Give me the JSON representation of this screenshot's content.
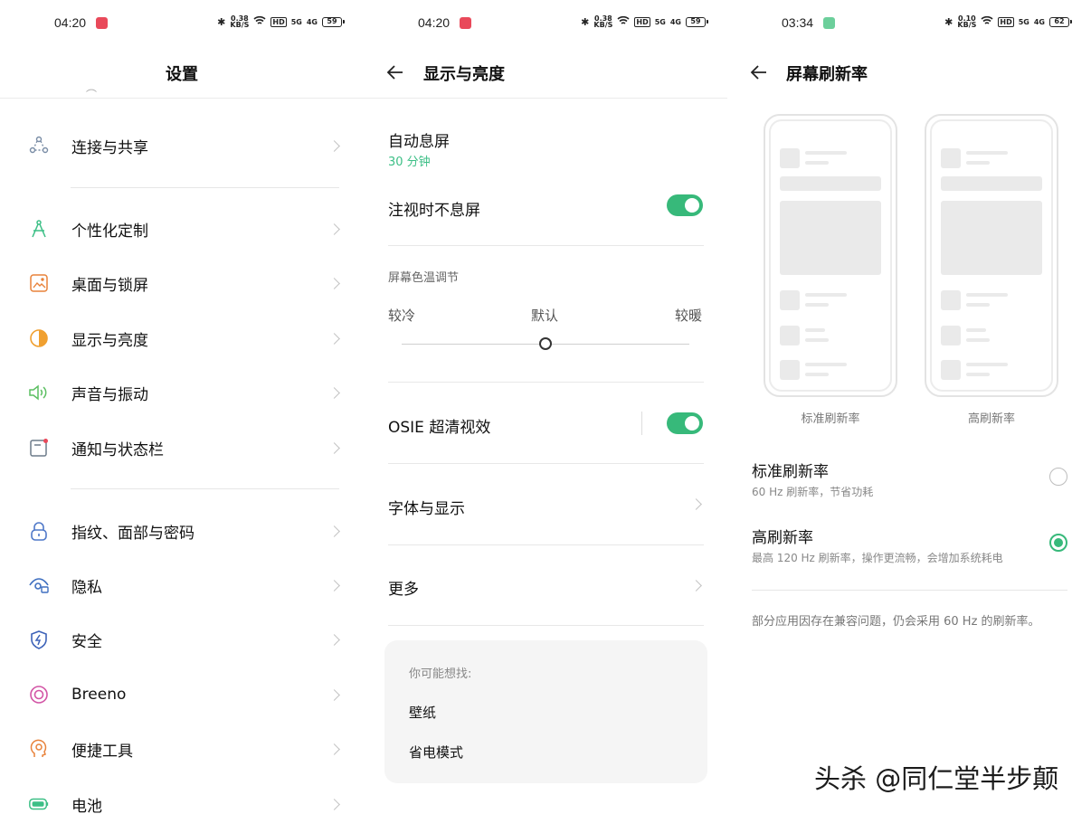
{
  "panel1": {
    "status": {
      "time": "04:20",
      "net_speed": "0.38",
      "net_unit": "KB/S",
      "hd": "HD",
      "sig1": "5G",
      "sig2": "4G",
      "battery": "59"
    },
    "title": "设置",
    "items": [
      {
        "label": "连接与共享",
        "icon": "share-nodes-icon",
        "color": "#7a8da6"
      },
      {
        "label": "个性化定制",
        "icon": "compass-icon",
        "color": "#3cbf86"
      },
      {
        "label": "桌面与锁屏",
        "icon": "wallpaper-icon",
        "color": "#e8823a"
      },
      {
        "label": "显示与亮度",
        "icon": "brightness-icon",
        "color": "#f0a030"
      },
      {
        "label": "声音与振动",
        "icon": "speaker-icon",
        "color": "#5cbf62"
      },
      {
        "label": "通知与状态栏",
        "icon": "notification-icon",
        "color": "#6d7b8a"
      },
      {
        "label": "指纹、面部与密码",
        "icon": "lock-icon",
        "color": "#4f78c8"
      },
      {
        "label": "隐私",
        "icon": "privacy-eye-icon",
        "color": "#3f6fc0"
      },
      {
        "label": "安全",
        "icon": "shield-icon",
        "color": "#3d62b8"
      },
      {
        "label": "Breeno",
        "icon": "breeno-icon",
        "color": "#d356a6"
      },
      {
        "label": "便捷工具",
        "icon": "tools-icon",
        "color": "#e8823a"
      },
      {
        "label": "电池",
        "icon": "battery-icon",
        "color": "#3cbf86"
      }
    ]
  },
  "panel2": {
    "status": {
      "time": "04:20",
      "net_speed": "0.38",
      "net_unit": "KB/S",
      "hd": "HD",
      "sig1": "5G",
      "sig2": "4G",
      "battery": "59"
    },
    "title": "显示与亮度",
    "auto_lock": {
      "label": "自动息屏",
      "value": "30 分钟"
    },
    "gaze": {
      "label": "注视时不息屏",
      "on": true
    },
    "color_temp": {
      "section": "屏幕色温调节",
      "cold": "较冷",
      "default": "默认",
      "warm": "较暖",
      "value": 0.5
    },
    "osie": {
      "label": "OSIE 超清视效",
      "on": true
    },
    "font": {
      "label": "字体与显示"
    },
    "more": {
      "label": "更多"
    },
    "suggest": {
      "hint": "你可能想找:",
      "links": [
        "壁纸",
        "省电模式"
      ]
    }
  },
  "panel3": {
    "status": {
      "time": "03:34",
      "net_speed": "0.10",
      "net_unit": "KB/S",
      "hd": "HD",
      "sig1": "5G",
      "sig2": "4G",
      "battery": "62"
    },
    "title": "屏幕刷新率",
    "preview_std": "标准刷新率",
    "preview_high": "高刷新率",
    "options": [
      {
        "title": "标准刷新率",
        "sub": "60 Hz 刷新率，节省功耗",
        "selected": false
      },
      {
        "title": "高刷新率",
        "sub": "最高 120 Hz 刷新率，操作更流畅，会增加系统耗电",
        "selected": true
      }
    ],
    "note": "部分应用因存在兼容问题，仍会采用 60 Hz 的刷新率。",
    "watermark": "头杀 @同仁堂半步颠"
  }
}
